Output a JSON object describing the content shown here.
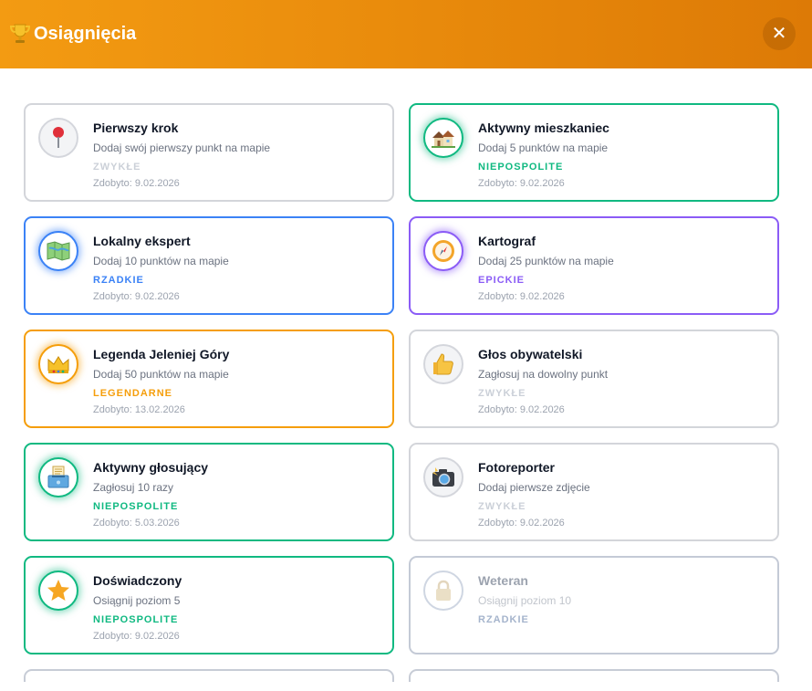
{
  "header": {
    "title": "Osiągnięcia",
    "close_label": "✕"
  },
  "colors": {
    "header_start": "#f39b12",
    "header_end": "#dd7a06",
    "common": "#d3d5da",
    "uncommon": "#10b981",
    "rare": "#3b82f6",
    "epic": "#8b5cf6",
    "legendary": "#f59e0b"
  },
  "achievements": [
    {
      "name": "Pierwszy krok",
      "desc": "Dodaj swój pierwszy punkt na mapie",
      "rarity": "ZWYKŁE",
      "date": "Zdobyto: 9.02.2026",
      "icon": "pushpin-icon"
    },
    {
      "name": "Aktywny mieszkaniec",
      "desc": "Dodaj 5 punktów na mapie",
      "rarity": "NIEPOSPOLITE",
      "date": "Zdobyto: 9.02.2026",
      "icon": "houses-icon"
    },
    {
      "name": "Lokalny ekspert",
      "desc": "Dodaj 10 punktów na mapie",
      "rarity": "RZADKIE",
      "date": "Zdobyto: 9.02.2026",
      "icon": "map-icon"
    },
    {
      "name": "Kartograf",
      "desc": "Dodaj 25 punktów na mapie",
      "rarity": "EPICKIE",
      "date": "Zdobyto: 9.02.2026",
      "icon": "compass-icon"
    },
    {
      "name": "Legenda Jeleniej Góry",
      "desc": "Dodaj 50 punktów na mapie",
      "rarity": "LEGENDARNE",
      "date": "Zdobyto: 13.02.2026",
      "icon": "crown-icon"
    },
    {
      "name": "Głos obywatelski",
      "desc": "Zagłosuj na dowolny punkt",
      "rarity": "ZWYKŁE",
      "date": "Zdobyto: 9.02.2026",
      "icon": "thumbs-up-icon"
    },
    {
      "name": "Aktywny głosujący",
      "desc": "Zagłosuj 10 razy",
      "rarity": "NIEPOSPOLITE",
      "date": "Zdobyto: 5.03.2026",
      "icon": "ballot-box-icon"
    },
    {
      "name": "Fotoreporter",
      "desc": "Dodaj pierwsze zdjęcie",
      "rarity": "ZWYKŁE",
      "date": "Zdobyto: 9.02.2026",
      "icon": "camera-flash-icon"
    },
    {
      "name": "Doświadczony",
      "desc": "Osiągnij poziom 5",
      "rarity": "NIEPOSPOLITE",
      "date": "Zdobyto: 9.02.2026",
      "icon": "star-icon"
    },
    {
      "name": "Weteran",
      "desc": "Osiągnij poziom 10",
      "rarity": "RZADKIE",
      "date": "",
      "icon": "lock-icon"
    }
  ]
}
